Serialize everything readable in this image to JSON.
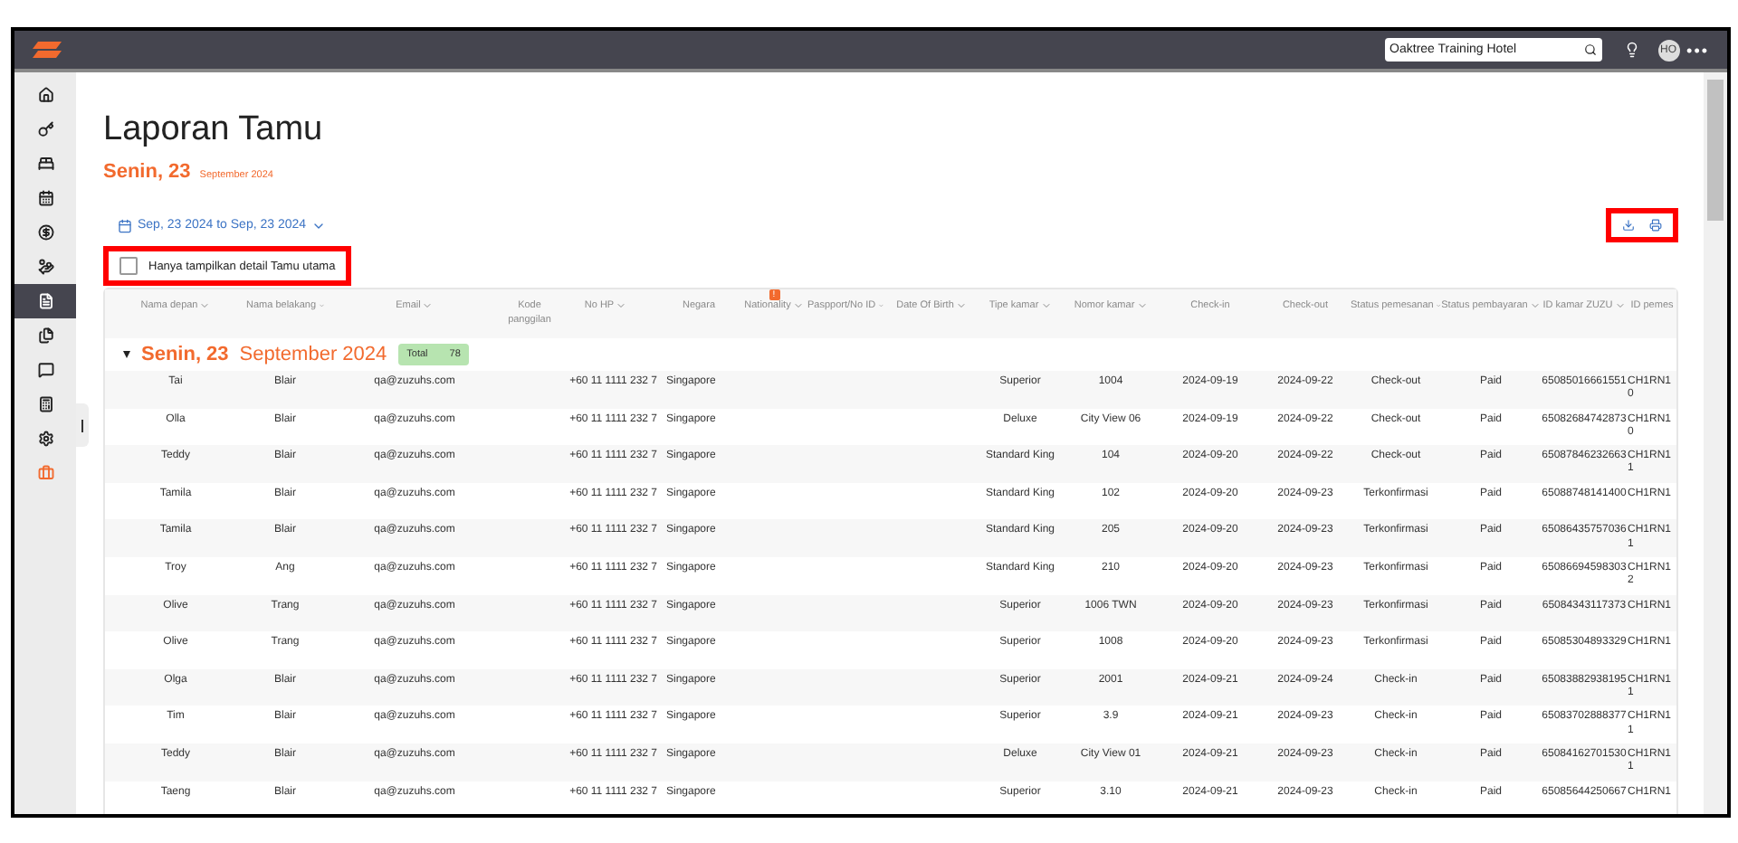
{
  "topbar": {
    "hotel_search": "Oaktree Training Hotel",
    "avatar": "HO",
    "more": "•••"
  },
  "sidebar": {
    "items": [
      {
        "kind": "home",
        "selected": false
      },
      {
        "kind": "key",
        "selected": false
      },
      {
        "kind": "bed",
        "selected": false
      },
      {
        "kind": "calendar",
        "selected": false
      },
      {
        "kind": "coin",
        "selected": false
      },
      {
        "kind": "hand",
        "selected": false
      },
      {
        "kind": "report",
        "selected": true
      },
      {
        "kind": "files",
        "selected": false
      },
      {
        "kind": "chat",
        "selected": false
      },
      {
        "kind": "register",
        "selected": false
      },
      {
        "kind": "gear",
        "selected": false
      },
      {
        "kind": "briefcase",
        "selected": false
      }
    ]
  },
  "title": "Laporan Tamu",
  "date_heading": {
    "day": "Senin, 23",
    "month": "September 2024"
  },
  "date_range": "Sep, 23 2024 to Sep, 23 2024",
  "filter": {
    "label": "Hanya tampilkan detail Tamu utama",
    "checked": false
  },
  "table": {
    "columns": [
      {
        "label": "Nama depan",
        "sortable": true
      },
      {
        "label": "Nama belakang",
        "sortable": true
      },
      {
        "label": "Email",
        "sortable": true
      },
      {
        "label": "Kode panggilan",
        "sortable": false
      },
      {
        "label": "No HP",
        "sortable": true
      },
      {
        "label": "Negara",
        "sortable": false
      },
      {
        "label": "Nationality",
        "sortable": true,
        "badge": "!"
      },
      {
        "label": "Paspport/No ID",
        "sortable": true
      },
      {
        "label": "Date Of Birth",
        "sortable": true
      },
      {
        "label": "Tipe kamar",
        "sortable": true
      },
      {
        "label": "Nomor kamar",
        "sortable": true
      },
      {
        "label": "Check-in",
        "sortable": false
      },
      {
        "label": "Check-out",
        "sortable": false
      },
      {
        "label": "Status pemesanan",
        "sortable": true
      },
      {
        "label": "Status pembayaran",
        "sortable": true
      },
      {
        "label": "ID kamar ZUZU",
        "sortable": true
      },
      {
        "label": "ID pemes",
        "sortable": false
      }
    ],
    "group": {
      "day": "Senin, 23",
      "month": "September 2024",
      "total_label": "Total",
      "total": "78",
      "expanded": true
    },
    "rows": [
      {
        "first": "Tai",
        "last": "Blair",
        "email": "qa@zuzuhs.com",
        "phone": "+60 11 1111 232 7",
        "country": "Singapore",
        "room_type": "Superior",
        "room": "1004",
        "check_in": "2024-09-19",
        "check_out": "2024-09-22",
        "status": "Check-out",
        "payment": "Paid",
        "zuzu_id": "65085016661551",
        "booking": "CH1RN1",
        "booking_2": "0"
      },
      {
        "first": "Olla",
        "last": "Blair",
        "email": "qa@zuzuhs.com",
        "phone": "+60 11 1111 232 7",
        "country": "Singapore",
        "room_type": "Deluxe",
        "room": "City View 06",
        "check_in": "2024-09-19",
        "check_out": "2024-09-22",
        "status": "Check-out",
        "payment": "Paid",
        "zuzu_id": "65082684742873",
        "booking": "CH1RN1",
        "booking_2": "0"
      },
      {
        "first": "Teddy",
        "last": "Blair",
        "email": "qa@zuzuhs.com",
        "phone": "+60 11 1111 232 7",
        "country": "Singapore",
        "room_type": "Standard King",
        "room": "104",
        "check_in": "2024-09-20",
        "check_out": "2024-09-22",
        "status": "Check-out",
        "payment": "Paid",
        "zuzu_id": "65087846232663",
        "booking": "CH1RN1",
        "booking_2": "1"
      },
      {
        "first": "Tamila",
        "last": "Blair",
        "email": "qa@zuzuhs.com",
        "phone": "+60 11 1111 232 7",
        "country": "Singapore",
        "room_type": "Standard King",
        "room": "102",
        "check_in": "2024-09-20",
        "check_out": "2024-09-23",
        "status": "Terkonfirmasi",
        "payment": "Paid",
        "zuzu_id": "65088748141400",
        "booking": "CH1RN1"
      },
      {
        "first": "Tamila",
        "last": "Blair",
        "email": "qa@zuzuhs.com",
        "phone": "+60 11 1111 232 7",
        "country": "Singapore",
        "room_type": "Standard King",
        "room": "205",
        "check_in": "2024-09-20",
        "check_out": "2024-09-23",
        "status": "Terkonfirmasi",
        "payment": "Paid",
        "zuzu_id": "65086435757036",
        "booking": "CH1RN1",
        "booking_2": "1"
      },
      {
        "first": "Troy",
        "last": "Ang",
        "email": "qa@zuzuhs.com",
        "phone": "+60 11 1111 232 7",
        "country": "Singapore",
        "room_type": "Standard King",
        "room": "210",
        "check_in": "2024-09-20",
        "check_out": "2024-09-23",
        "status": "Terkonfirmasi",
        "payment": "Paid",
        "zuzu_id": "65086694598303",
        "booking": "CH1RN1",
        "booking_2": "2"
      },
      {
        "first": "Olive",
        "last": "Trang",
        "email": "qa@zuzuhs.com",
        "phone": "+60 11 1111 232 7",
        "country": "Singapore",
        "room_type": "Superior",
        "room": "1006 TWN",
        "check_in": "2024-09-20",
        "check_out": "2024-09-23",
        "status": "Terkonfirmasi",
        "payment": "Paid",
        "zuzu_id": "65084343117373",
        "booking": "CH1RN1"
      },
      {
        "first": "Olive",
        "last": "Trang",
        "email": "qa@zuzuhs.com",
        "phone": "+60 11 1111 232 7",
        "country": "Singapore",
        "room_type": "Superior",
        "room": "1008",
        "check_in": "2024-09-20",
        "check_out": "2024-09-23",
        "status": "Terkonfirmasi",
        "payment": "Paid",
        "zuzu_id": "65085304893329",
        "booking": "CH1RN1"
      },
      {
        "first": "Olga",
        "last": "Blair",
        "email": "qa@zuzuhs.com",
        "phone": "+60 11 1111 232 7",
        "country": "Singapore",
        "room_type": "Superior",
        "room": "2001",
        "check_in": "2024-09-21",
        "check_out": "2024-09-24",
        "status": "Check-in",
        "payment": "Paid",
        "zuzu_id": "65083882938195",
        "booking": "CH1RN1",
        "booking_2": "1"
      },
      {
        "first": "Tim",
        "last": "Blair",
        "email": "qa@zuzuhs.com",
        "phone": "+60 11 1111 232 7",
        "country": "Singapore",
        "room_type": "Superior",
        "room": "3.9",
        "check_in": "2024-09-21",
        "check_out": "2024-09-23",
        "status": "Check-in",
        "payment": "Paid",
        "zuzu_id": "65083702888377",
        "booking": "CH1RN1",
        "booking_2": "1"
      },
      {
        "first": "Teddy",
        "last": "Blair",
        "email": "qa@zuzuhs.com",
        "phone": "+60 11 1111 232 7",
        "country": "Singapore",
        "room_type": "Deluxe",
        "room": "City View 01",
        "check_in": "2024-09-21",
        "check_out": "2024-09-23",
        "status": "Check-in",
        "payment": "Paid",
        "zuzu_id": "65084162701530",
        "booking": "CH1RN1",
        "booking_2": "1"
      },
      {
        "first": "Taeng",
        "last": "Blair",
        "email": "qa@zuzuhs.com",
        "phone": "+60 11 1111 232 7",
        "country": "Singapore",
        "room_type": "Superior",
        "room": "3.10",
        "check_in": "2024-09-21",
        "check_out": "2024-09-23",
        "status": "Check-in",
        "payment": "Paid",
        "zuzu_id": "65085644250667",
        "booking": "CH1RN1"
      }
    ]
  }
}
